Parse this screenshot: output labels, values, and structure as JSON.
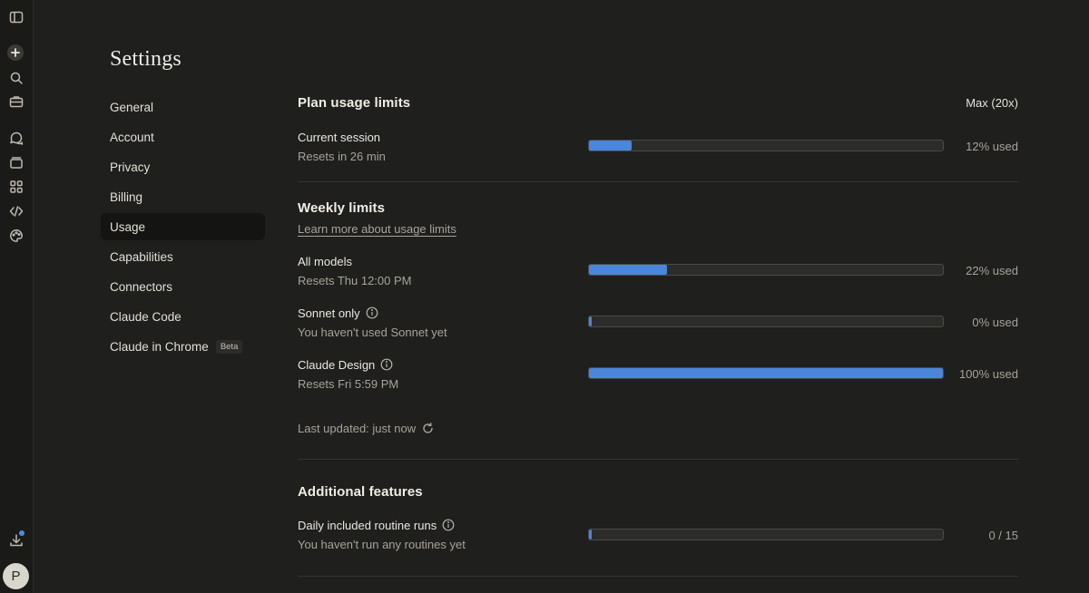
{
  "rail": {
    "icons": [
      "sidebar-toggle-icon",
      "new-chat-icon",
      "search-icon",
      "toolbox-icon",
      "chats-icon",
      "projects-icon",
      "artifacts-icon",
      "code-icon",
      "palette-icon",
      "download-icon"
    ],
    "avatar_initial": "P",
    "accent": "#4b8ee6"
  },
  "page": {
    "title": "Settings"
  },
  "nav": {
    "items": [
      {
        "label": "General"
      },
      {
        "label": "Account"
      },
      {
        "label": "Privacy"
      },
      {
        "label": "Billing"
      },
      {
        "label": "Usage"
      },
      {
        "label": "Capabilities"
      },
      {
        "label": "Connectors"
      },
      {
        "label": "Claude Code"
      },
      {
        "label": "Claude in Chrome",
        "badge": "Beta"
      }
    ],
    "active": "Usage"
  },
  "plan": {
    "title": "Plan usage limits",
    "badge": "Max (20x)",
    "current_session": {
      "label": "Current session",
      "sub": "Resets in 26 min",
      "value_text": "12% used",
      "fill_percent": 12
    }
  },
  "weekly": {
    "title": "Weekly limits",
    "link": "Learn more about usage limits",
    "rows": [
      {
        "label": "All models",
        "sub": "Resets Thu 12:00 PM",
        "value_text": "22% used",
        "fill_percent": 22,
        "info": false
      },
      {
        "label": "Sonnet only",
        "sub": "You haven't used Sonnet yet",
        "value_text": "0% used",
        "fill_percent": 0,
        "info": true
      },
      {
        "label": "Claude Design",
        "sub": "Resets Fri 5:59 PM",
        "value_text": "100% used",
        "fill_percent": 100,
        "info": true
      }
    ],
    "last_updated": "Last updated: just now"
  },
  "additional": {
    "title": "Additional features",
    "row": {
      "label": "Daily included routine runs",
      "sub": "You haven't run any routines yet",
      "value_text": "0 / 15",
      "fill_percent": 0
    }
  },
  "colors": {
    "bar_fill": "#4a86db",
    "background": "#1f1f1e"
  }
}
